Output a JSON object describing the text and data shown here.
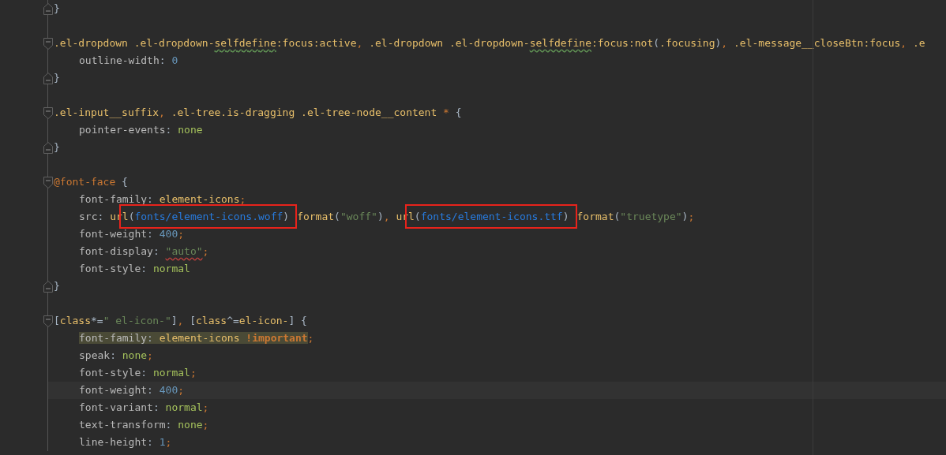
{
  "editor": {
    "lines": [
      {
        "kind": "close",
        "tokens": [
          {
            "text": "}",
            "kind": "punct"
          }
        ]
      },
      {
        "kind": "blank"
      },
      {
        "kind": "rule",
        "tokens": [
          {
            "text": ".el-dropdown .el-dropdown-",
            "kind": "selector"
          },
          {
            "text": "selfdefine",
            "kind": "misspelled"
          },
          {
            "text": ":focus:active",
            "kind": "selector"
          },
          {
            "text": ", ",
            "kind": "comma"
          },
          {
            "text": ".el-dropdown .el-dropdown-",
            "kind": "selector"
          },
          {
            "text": "selfdefine",
            "kind": "misspelled"
          },
          {
            "text": ":focus:not",
            "kind": "selector"
          },
          {
            "text": "(",
            "kind": "punct"
          },
          {
            "text": ".focusing",
            "kind": "selector"
          },
          {
            "text": ")",
            "kind": "punct"
          },
          {
            "text": ", ",
            "kind": "comma"
          },
          {
            "text": ".el-message__closeBtn:focus",
            "kind": "selector"
          },
          {
            "text": ", ",
            "kind": "comma"
          },
          {
            "text": ".e",
            "kind": "selector"
          }
        ]
      },
      {
        "kind": "declaration",
        "tokens": [
          {
            "text": "outline-width",
            "kind": "property"
          },
          {
            "text": ": ",
            "kind": "punct"
          },
          {
            "text": "0",
            "kind": "number"
          }
        ]
      },
      {
        "kind": "close",
        "tokens": [
          {
            "text": "}",
            "kind": "punct"
          }
        ]
      },
      {
        "kind": "blank"
      },
      {
        "kind": "rule",
        "tokens": [
          {
            "text": ".el-input__suffix",
            "kind": "selector"
          },
          {
            "text": ", ",
            "kind": "comma"
          },
          {
            "text": ".el-tree.is-dragging .el-tree-node__content ",
            "kind": "selector"
          },
          {
            "text": "*",
            "kind": "comma"
          },
          {
            "text": " {",
            "kind": "punct"
          }
        ]
      },
      {
        "kind": "declaration",
        "tokens": [
          {
            "text": "pointer-events",
            "kind": "property"
          },
          {
            "text": ": ",
            "kind": "punct"
          },
          {
            "text": "none",
            "kind": "keyword"
          }
        ]
      },
      {
        "kind": "close",
        "tokens": [
          {
            "text": "}",
            "kind": "punct"
          }
        ]
      },
      {
        "kind": "blank"
      },
      {
        "kind": "rule",
        "tokens": [
          {
            "text": "@font-face",
            "kind": "atrule"
          },
          {
            "text": " {",
            "kind": "punct"
          }
        ]
      },
      {
        "kind": "declaration",
        "tokens": [
          {
            "text": "font-family",
            "kind": "property"
          },
          {
            "text": ": ",
            "kind": "punct"
          },
          {
            "text": "element-icons",
            "kind": "selector"
          },
          {
            "text": ";",
            "kind": "comma"
          }
        ]
      },
      {
        "kind": "declaration",
        "tokens": [
          {
            "text": "src",
            "kind": "property"
          },
          {
            "text": ": ",
            "kind": "punct"
          },
          {
            "text": "ur",
            "kind": "selector"
          },
          {
            "text": "l",
            "kind": "selector",
            "boxed": true
          },
          {
            "text": "(",
            "kind": "punct",
            "boxed": true
          },
          {
            "text": "fonts/element-icons.woff",
            "kind": "url",
            "boxed": true
          },
          {
            "text": ")",
            "kind": "punct",
            "boxed": true
          },
          {
            "text": "format",
            "kind": "selector"
          },
          {
            "text": "(",
            "kind": "punct"
          },
          {
            "text": "\"woff\"",
            "kind": "string"
          },
          {
            "text": ")",
            "kind": "punct"
          },
          {
            "text": ", ",
            "kind": "comma"
          },
          {
            "text": "ur",
            "kind": "selector"
          },
          {
            "text": "l",
            "kind": "selector",
            "boxed": true
          },
          {
            "text": "(",
            "kind": "punct",
            "boxed": true
          },
          {
            "text": "fonts/element-icons.ttf",
            "kind": "url",
            "boxed": true
          },
          {
            "text": ")",
            "kind": "punct",
            "boxed": true
          },
          {
            "text": "format",
            "kind": "selector"
          },
          {
            "text": "(",
            "kind": "punct"
          },
          {
            "text": "\"truetype\"",
            "kind": "string"
          },
          {
            "text": ")",
            "kind": "punct"
          },
          {
            "text": ";",
            "kind": "comma"
          }
        ]
      },
      {
        "kind": "declaration",
        "tokens": [
          {
            "text": "font-weight",
            "kind": "property"
          },
          {
            "text": ": ",
            "kind": "punct"
          },
          {
            "text": "400",
            "kind": "number"
          },
          {
            "text": ";",
            "kind": "comma"
          }
        ]
      },
      {
        "kind": "declaration",
        "tokens": [
          {
            "text": "font-display",
            "kind": "property"
          },
          {
            "text": ": ",
            "kind": "punct"
          },
          {
            "text": "\"auto\"",
            "kind": "invalid"
          },
          {
            "text": ";",
            "kind": "comma"
          }
        ]
      },
      {
        "kind": "declaration",
        "tokens": [
          {
            "text": "font-style",
            "kind": "property"
          },
          {
            "text": ": ",
            "kind": "punct"
          },
          {
            "text": "normal",
            "kind": "keyword"
          }
        ]
      },
      {
        "kind": "close",
        "tokens": [
          {
            "text": "}",
            "kind": "punct"
          }
        ]
      },
      {
        "kind": "blank"
      },
      {
        "kind": "rule",
        "tokens": [
          {
            "text": "[",
            "kind": "punct"
          },
          {
            "text": "class",
            "kind": "selector"
          },
          {
            "text": "*=",
            "kind": "punct"
          },
          {
            "text": "\" el-icon-\"",
            "kind": "string"
          },
          {
            "text": "]",
            "kind": "punct"
          },
          {
            "text": ", ",
            "kind": "comma"
          },
          {
            "text": "[",
            "kind": "punct"
          },
          {
            "text": "class",
            "kind": "selector"
          },
          {
            "text": "^=",
            "kind": "punct"
          },
          {
            "text": "el-icon-",
            "kind": "selector"
          },
          {
            "text": "]",
            "kind": "punct"
          },
          {
            "text": " {",
            "kind": "punct"
          }
        ]
      },
      {
        "kind": "declaration",
        "tokens": [
          {
            "text": "font-family",
            "kind": "property",
            "highlighted": true
          },
          {
            "text": ": ",
            "kind": "punct",
            "highlighted": true
          },
          {
            "text": "element-icons ",
            "kind": "selector",
            "highlighted": true
          },
          {
            "text": "!important",
            "kind": "important",
            "highlighted": true
          },
          {
            "text": ";",
            "kind": "comma"
          }
        ]
      },
      {
        "kind": "declaration",
        "tokens": [
          {
            "text": "speak",
            "kind": "property"
          },
          {
            "text": ": ",
            "kind": "punct"
          },
          {
            "text": "none",
            "kind": "keyword"
          },
          {
            "text": ";",
            "kind": "comma"
          }
        ]
      },
      {
        "kind": "declaration",
        "tokens": [
          {
            "text": "font-style",
            "kind": "property"
          },
          {
            "text": ": ",
            "kind": "punct"
          },
          {
            "text": "normal",
            "kind": "keyword"
          },
          {
            "text": ";",
            "kind": "comma"
          }
        ]
      },
      {
        "kind": "declaration",
        "current": true,
        "tokens": [
          {
            "text": "font-weight",
            "kind": "property"
          },
          {
            "text": ": ",
            "kind": "punct"
          },
          {
            "text": "400",
            "kind": "number"
          },
          {
            "text": ";",
            "kind": "comma"
          }
        ]
      },
      {
        "kind": "declaration",
        "tokens": [
          {
            "text": "font-variant",
            "kind": "property"
          },
          {
            "text": ": ",
            "kind": "punct"
          },
          {
            "text": "normal",
            "kind": "keyword"
          },
          {
            "text": ";",
            "kind": "comma"
          }
        ]
      },
      {
        "kind": "declaration",
        "tokens": [
          {
            "text": "text-transform",
            "kind": "property"
          },
          {
            "text": ": ",
            "kind": "punct"
          },
          {
            "text": "none",
            "kind": "keyword"
          },
          {
            "text": ";",
            "kind": "comma"
          }
        ]
      },
      {
        "kind": "declaration",
        "tokens": [
          {
            "text": "line-height",
            "kind": "property"
          },
          {
            "text": ": ",
            "kind": "punct"
          },
          {
            "text": "1",
            "kind": "number"
          },
          {
            "text": ";",
            "kind": "comma"
          }
        ]
      }
    ]
  }
}
